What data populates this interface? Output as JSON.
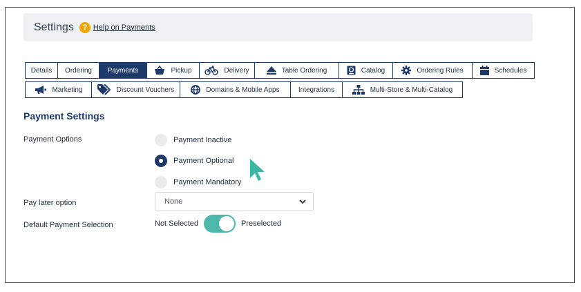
{
  "header": {
    "title": "Settings",
    "help_link": "Help on Payments"
  },
  "tabs_row1": [
    {
      "label": "Details",
      "icon": "",
      "active": false
    },
    {
      "label": "Ordering",
      "icon": "",
      "active": false
    },
    {
      "label": "Payments",
      "icon": "",
      "active": true
    },
    {
      "label": "Pickup",
      "icon": "basket-icon",
      "active": false
    },
    {
      "label": "Delivery",
      "icon": "bicycle-icon",
      "active": false
    },
    {
      "label": "Table Ordering",
      "icon": "eject-icon",
      "active": false
    },
    {
      "label": "Catalog",
      "icon": "catalog-icon",
      "active": false
    },
    {
      "label": "Ordering Rules",
      "icon": "cog-icon",
      "active": false
    },
    {
      "label": "Schedules",
      "icon": "calendar-icon",
      "active": false
    }
  ],
  "tabs_row2": [
    {
      "label": "Marketing",
      "icon": "megaphone-icon",
      "active": false
    },
    {
      "label": "Discount Vouchers",
      "icon": "tags-icon",
      "active": false
    },
    {
      "label": "Domains & Mobile Apps",
      "icon": "globe-icon",
      "active": false
    },
    {
      "label": "Integrations",
      "icon": "",
      "active": false
    },
    {
      "label": "Multi-Store & Multi-Catalog",
      "icon": "sitemap-icon",
      "active": false
    }
  ],
  "payment_settings": {
    "title": "Payment Settings",
    "options_label": "Payment Options",
    "options": [
      {
        "label": "Payment Inactive",
        "checked": false
      },
      {
        "label": "Payment Optional",
        "checked": true
      },
      {
        "label": "Payment Mandatory",
        "checked": false
      }
    ],
    "pay_later_label": "Pay later option",
    "pay_later_value": "None",
    "default_selection_label": "Default Payment Selection",
    "toggle_off_label": "Not Selected",
    "toggle_on_label": "Preselected"
  },
  "colors": {
    "accent": "#1e3a6b",
    "toggle": "#4bb8a9",
    "help": "#f0a500"
  }
}
